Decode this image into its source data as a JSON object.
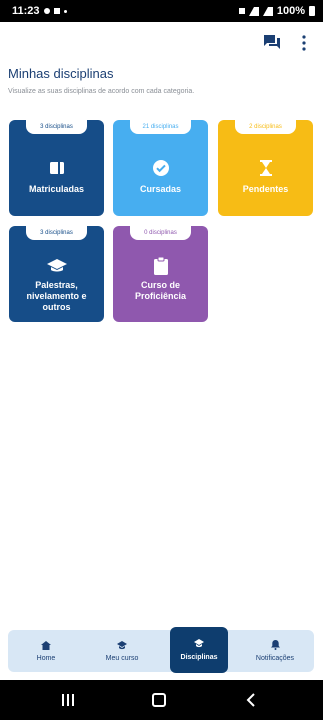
{
  "status_bar": {
    "time": "11:23",
    "battery": "100%"
  },
  "header": {
    "chat_icon": "chat-icon",
    "more_icon": "more-vert-icon"
  },
  "page": {
    "title": "Minhas disciplinas",
    "subtitle": "Visualize as suas disciplinas de acordo com cada categoria."
  },
  "categories": [
    {
      "count": "3 disciplinas",
      "label": "Matriculadas",
      "icon": "book-icon",
      "color": "#164d88"
    },
    {
      "count": "21 disciplinas",
      "label": "Cursadas",
      "icon": "check-circle-icon",
      "color": "#47aef0"
    },
    {
      "count": "2 disciplinas",
      "label": "Pendentes",
      "icon": "hourglass-icon",
      "color": "#f7bc15"
    },
    {
      "count": "3 disciplinas",
      "label": "Palestras, nivelamento e outros",
      "icon": "graduation-cap-icon",
      "color": "#164d88"
    },
    {
      "count": "0 disciplinas",
      "label": "Curso de Proficiência",
      "icon": "clipboard-icon",
      "color": "#8f58ae"
    }
  ],
  "bottom_nav": {
    "items": [
      {
        "label": "Home",
        "icon": "home-icon",
        "active": false
      },
      {
        "label": "Meu curso",
        "icon": "school-icon",
        "active": false
      },
      {
        "label": "Disciplinas",
        "icon": "school-icon",
        "active": true
      },
      {
        "label": "Notificações",
        "icon": "bell-icon",
        "active": false
      }
    ]
  }
}
